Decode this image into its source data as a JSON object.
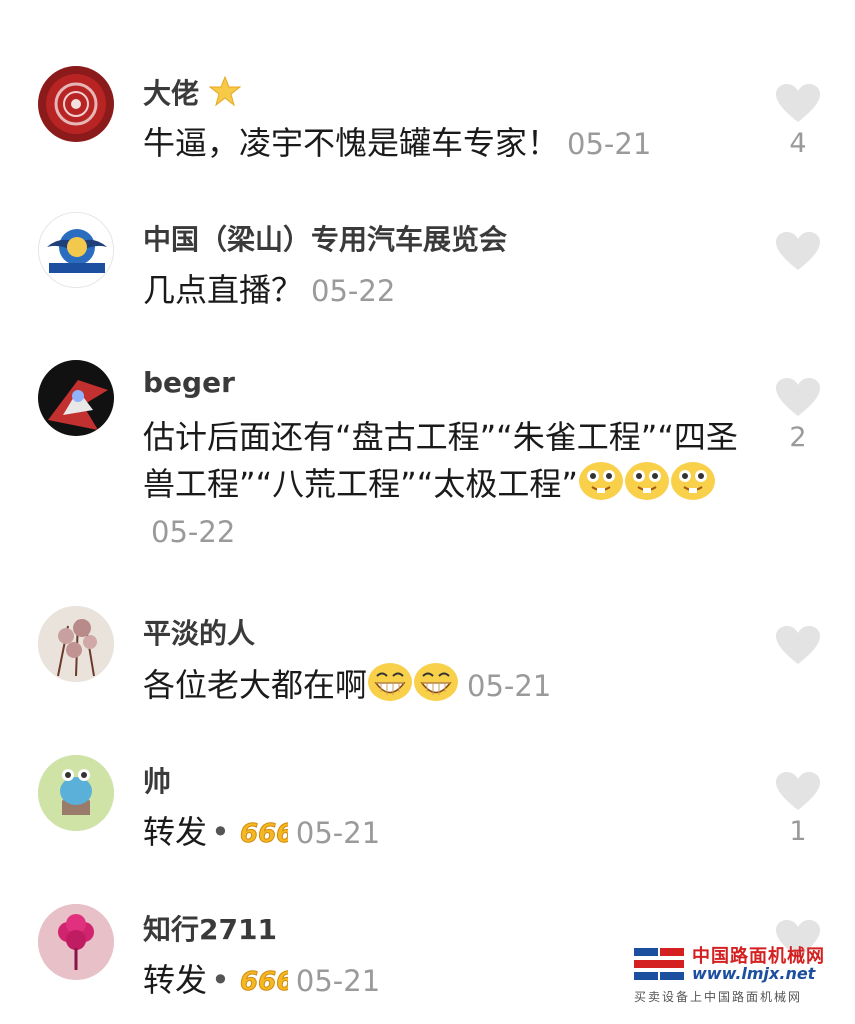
{
  "comments": [
    {
      "name": "大佬",
      "badge": "star",
      "text": "牛逼，凌宇不愧是罐车专家！",
      "date": "05-21",
      "likes": "4"
    },
    {
      "name": "中国（梁山）专用汽车展览会",
      "text": "几点直播？",
      "date": "05-22",
      "likes": ""
    },
    {
      "name": "beger",
      "text": "估计后面还有“盘古工程”“朱雀工程”“四圣兽工程”“八荒工程”“太极工程”",
      "date": "05-22",
      "likes": "2"
    },
    {
      "name": "平淡的人",
      "text": "各位老大都在啊",
      "date": "05-21",
      "likes": ""
    },
    {
      "name": "帅",
      "text": "转发",
      "dot": "•",
      "date": "05-21",
      "likes": "1"
    },
    {
      "name": "知行2711",
      "text": "转发",
      "dot": "•",
      "date": "05-21",
      "likes": ""
    }
  ],
  "icons": {
    "like": "heart-icon",
    "star": "star-icon",
    "grin_emoji": "grin-emoji",
    "laugh_emoji": "laugh-emoji",
    "sticker": "666-sticker"
  },
  "colors": {
    "heart": "#e3e3e3",
    "date": "#9a9a9a",
    "watermark_red": "#d42020",
    "watermark_blue": "#1c4fa0"
  },
  "watermark": {
    "title": "中国路面机械网",
    "url": "www.lmjx.net",
    "slogan": "买卖设备上中国路面机械网"
  }
}
